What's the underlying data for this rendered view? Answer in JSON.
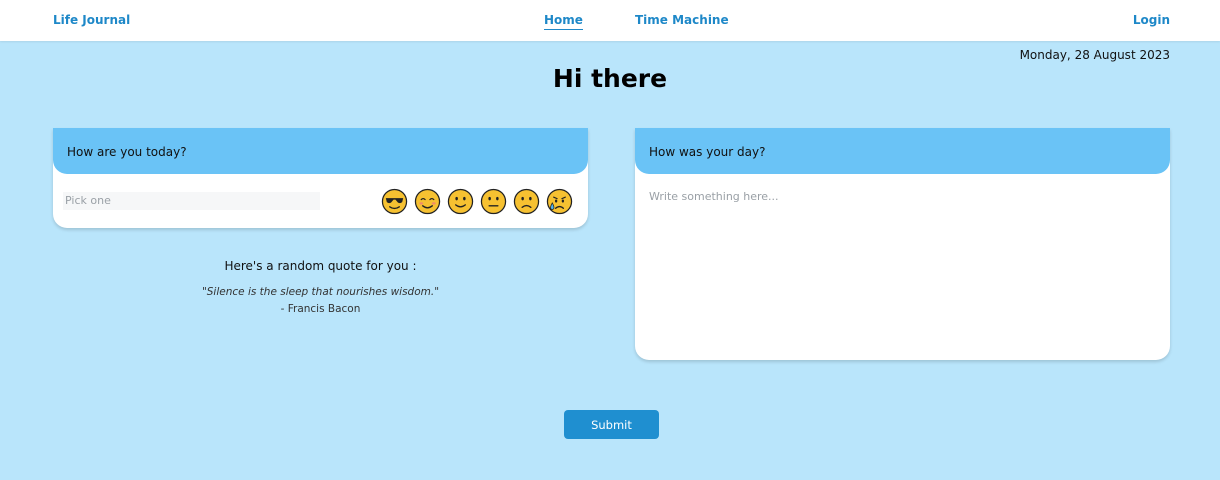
{
  "nav": {
    "brand": "Life Journal",
    "links": [
      {
        "label": "Home",
        "active": true
      },
      {
        "label": "Time Machine",
        "active": false
      }
    ],
    "login": "Login"
  },
  "date": "Monday, 28 August 2023",
  "greeting": "Hi there",
  "mood": {
    "title": "How are you today?",
    "placeholder": "Pick one",
    "emojis": [
      "cool-sunglasses",
      "smiling-blush",
      "slightly-smiling",
      "neutral",
      "slightly-frowning",
      "sad-tear"
    ]
  },
  "quote": {
    "heading": "Here's a random quote for you :",
    "text": "\"Silence is the sleep that nourishes wisdom.\"",
    "author": "- Francis Bacon"
  },
  "day": {
    "title": "How was your day?",
    "placeholder": "Write something here..."
  },
  "submit": "Submit",
  "colors": {
    "background": "#b9e5fb",
    "accent": "#1e88c8",
    "card_header": "#6ac3f6",
    "emoji_face": "#f6c131"
  }
}
